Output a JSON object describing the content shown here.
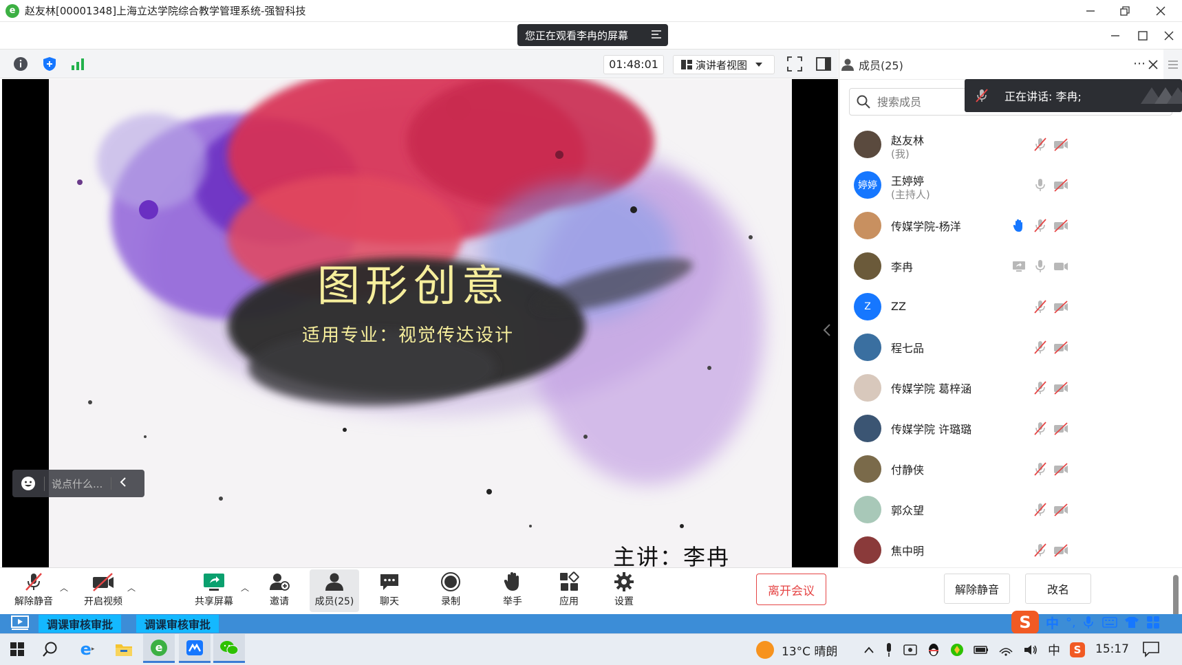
{
  "window": {
    "title": "赵友林[00001348]上海立达学院综合教学管理系统-强智科技"
  },
  "meeting": {
    "watching_banner": "您正在观看李冉的屏幕",
    "timer": "01:48:01",
    "view_mode": "演讲者视图",
    "chat_placeholder": "说点什么..."
  },
  "slide": {
    "title": "图形创意",
    "subtitle": "适用专业：视觉传达设计",
    "speaker": "主讲：李冉"
  },
  "toolbar": {
    "unmute": "解除静音",
    "start_video": "开启视频",
    "share_screen": "共享屏幕",
    "invite": "邀请",
    "members": "成员(25)",
    "chat": "聊天",
    "record": "录制",
    "raise_hand": "举手",
    "apps": "应用",
    "settings": "设置",
    "leave": "离开会议"
  },
  "members_panel": {
    "title": "成员(25)",
    "search_placeholder": "搜索成员",
    "speaking_toast": "正在讲话: 李冉;",
    "unmute_btn": "解除静音",
    "rename_btn": "改名",
    "members": [
      {
        "name": "赵友林",
        "role": "(我)",
        "avatar_color": "#5a4a3e",
        "avatar_text": "",
        "hand": false,
        "screen": false,
        "mic_muted": true,
        "cam_off": true
      },
      {
        "name": "王婷婷",
        "role": "(主持人)",
        "avatar_color": "#1677ff",
        "avatar_text": "婷婷",
        "hand": false,
        "screen": false,
        "mic_muted": false,
        "cam_off": true
      },
      {
        "name": "传媒学院-杨洋",
        "role": "",
        "avatar_color": "#c89060",
        "avatar_text": "",
        "hand": true,
        "screen": false,
        "mic_muted": true,
        "cam_off": true
      },
      {
        "name": "李冉",
        "role": "",
        "avatar_color": "#6b5a3a",
        "avatar_text": "",
        "hand": false,
        "screen": true,
        "mic_muted": false,
        "cam_off": false
      },
      {
        "name": "ZZ",
        "role": "",
        "avatar_color": "#1677ff",
        "avatar_text": "Z",
        "hand": false,
        "screen": false,
        "mic_muted": true,
        "cam_off": true
      },
      {
        "name": "程七品",
        "role": "",
        "avatar_color": "#3a6fa0",
        "avatar_text": "",
        "hand": false,
        "screen": false,
        "mic_muted": true,
        "cam_off": true
      },
      {
        "name": "传媒学院 葛梓涵",
        "role": "",
        "avatar_color": "#d8c8bc",
        "avatar_text": "",
        "hand": false,
        "screen": false,
        "mic_muted": true,
        "cam_off": true
      },
      {
        "name": "传媒学院 许璐璐",
        "role": "",
        "avatar_color": "#3b5573",
        "avatar_text": "",
        "hand": false,
        "screen": false,
        "mic_muted": true,
        "cam_off": true
      },
      {
        "name": "付静侠",
        "role": "",
        "avatar_color": "#7a6a4a",
        "avatar_text": "",
        "hand": false,
        "screen": false,
        "mic_muted": true,
        "cam_off": true
      },
      {
        "name": "郭众望",
        "role": "",
        "avatar_color": "#a8c8b8",
        "avatar_text": "",
        "hand": false,
        "screen": false,
        "mic_muted": true,
        "cam_off": true
      },
      {
        "name": "焦中明",
        "role": "",
        "avatar_color": "#8a3a3a",
        "avatar_text": "",
        "hand": false,
        "screen": false,
        "mic_muted": true,
        "cam_off": true
      }
    ]
  },
  "strip": {
    "btn1": "调课审核审批",
    "btn2": "调课审核审批",
    "ime_lang": "中"
  },
  "taskbar": {
    "weather": "13°C 晴朗",
    "tray_lang": "中",
    "clock": "15:17"
  },
  "colors": {
    "accent_blue": "#1677ff",
    "leave_red": "#e54545",
    "muted_red": "#e54545"
  }
}
